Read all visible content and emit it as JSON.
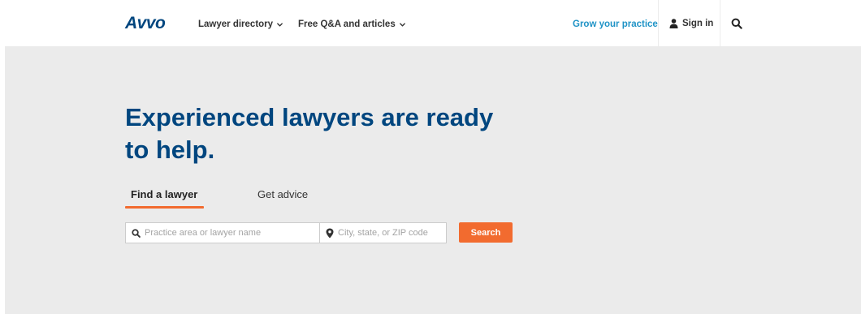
{
  "brand": {
    "logo_text": "Avvo",
    "primary_color": "#00467f",
    "accent_color": "#f26b2f",
    "link_color": "#1f93c6"
  },
  "nav": {
    "items": [
      {
        "label": "Lawyer directory",
        "icon": "chevron-down-icon"
      },
      {
        "label": "Free Q&A and articles",
        "icon": "chevron-down-icon"
      }
    ],
    "grow_label": "Grow your practice",
    "signin": {
      "label": "Sign in",
      "icon": "user-icon"
    },
    "search_icon": "search-icon"
  },
  "hero": {
    "headline": "Experienced lawyers are ready to help.",
    "background_color": "#ebebeb",
    "tabs": [
      {
        "label": "Find a lawyer",
        "active": true
      },
      {
        "label": "Get advice",
        "active": false
      }
    ],
    "practice_input": {
      "icon": "search-icon",
      "value": "",
      "placeholder": "Practice area or lawyer name"
    },
    "location_input": {
      "icon": "map-pin-icon",
      "value": "",
      "placeholder": "City, state, or ZIP code"
    },
    "search_button_label": "Search"
  }
}
